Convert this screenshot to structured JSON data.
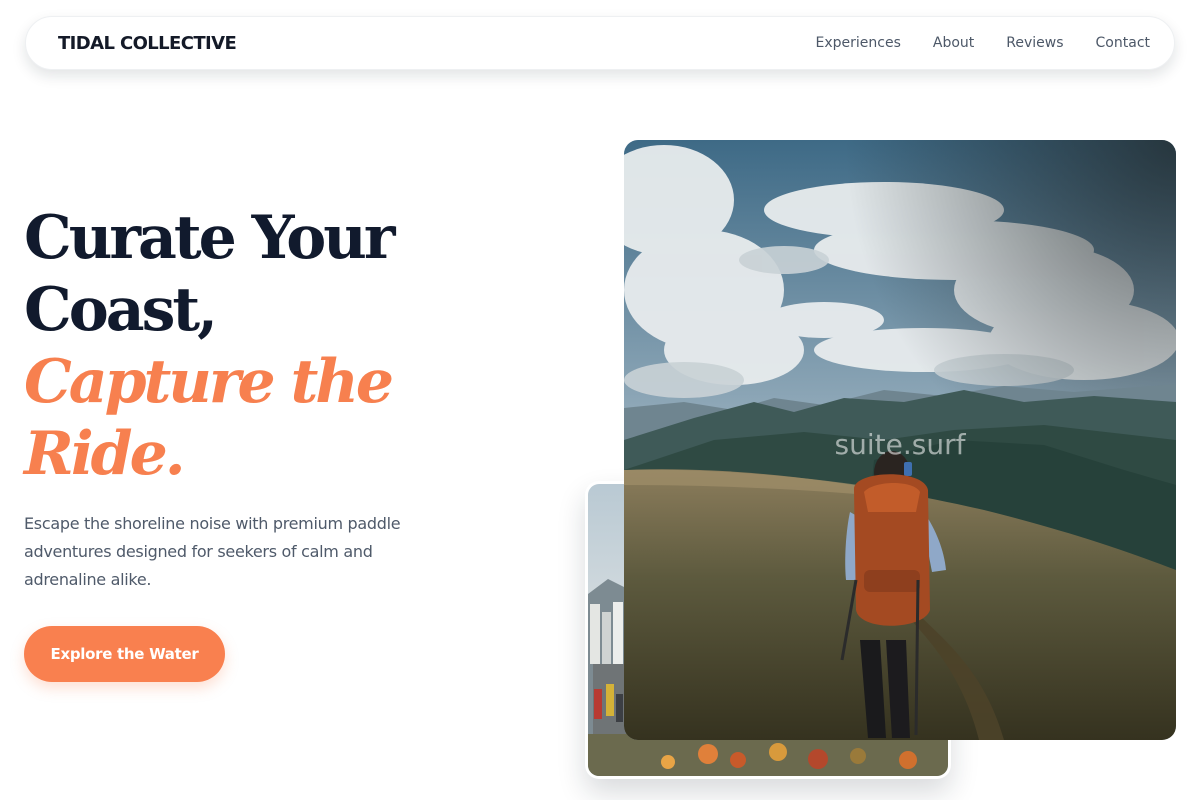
{
  "nav": {
    "brand": "TIDAL COLLECTIVE",
    "links": [
      "Experiences",
      "About",
      "Reviews",
      "Contact"
    ]
  },
  "hero": {
    "title_line1": "Curate Your",
    "title_line2": "Coast,",
    "title_accent_line1": "Capture the",
    "title_accent_line2": "Ride.",
    "subtitle": "Escape the shoreline noise with premium paddle adventures designed for seekers of calm and adrenaline alike.",
    "cta_label": "Explore the Water"
  },
  "images": {
    "main_watermark": "suite.surf",
    "main_image": "hiker-mountain-photo",
    "secondary_image": "coastal-city-crowd-photo"
  },
  "colors": {
    "accent": "#f7804f",
    "heading": "#111a2d",
    "body_text": "#4f5a6a",
    "nav_text": "#4d5868"
  }
}
